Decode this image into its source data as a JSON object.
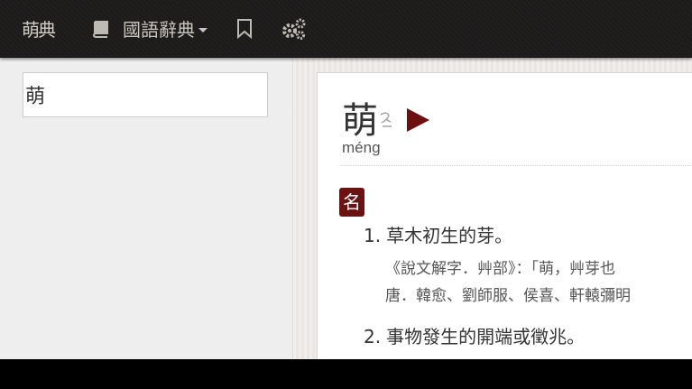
{
  "topbar": {
    "logo_text": "萌典",
    "dictionary_label": "國語辭典",
    "icons": {
      "book": "book-icon",
      "bookmark": "bookmark-icon",
      "settings": "gears-icon"
    }
  },
  "search": {
    "value": "萌"
  },
  "entry": {
    "headword": "萌",
    "pinyin": "méng",
    "part_of_speech": "名",
    "definitions": [
      {
        "number": "1.",
        "text": "草木初生的芽。",
        "examples": [
          "《說文解字．艸部》：「萌，艸芽也",
          "唐．韓愈、劉師服、侯喜、軒轅彌明"
        ]
      },
      {
        "number": "2.",
        "text": "事物發生的開端或徵兆。"
      }
    ]
  },
  "colors": {
    "accent": "#6b0f0f",
    "topbar": "#1d1b1a"
  }
}
